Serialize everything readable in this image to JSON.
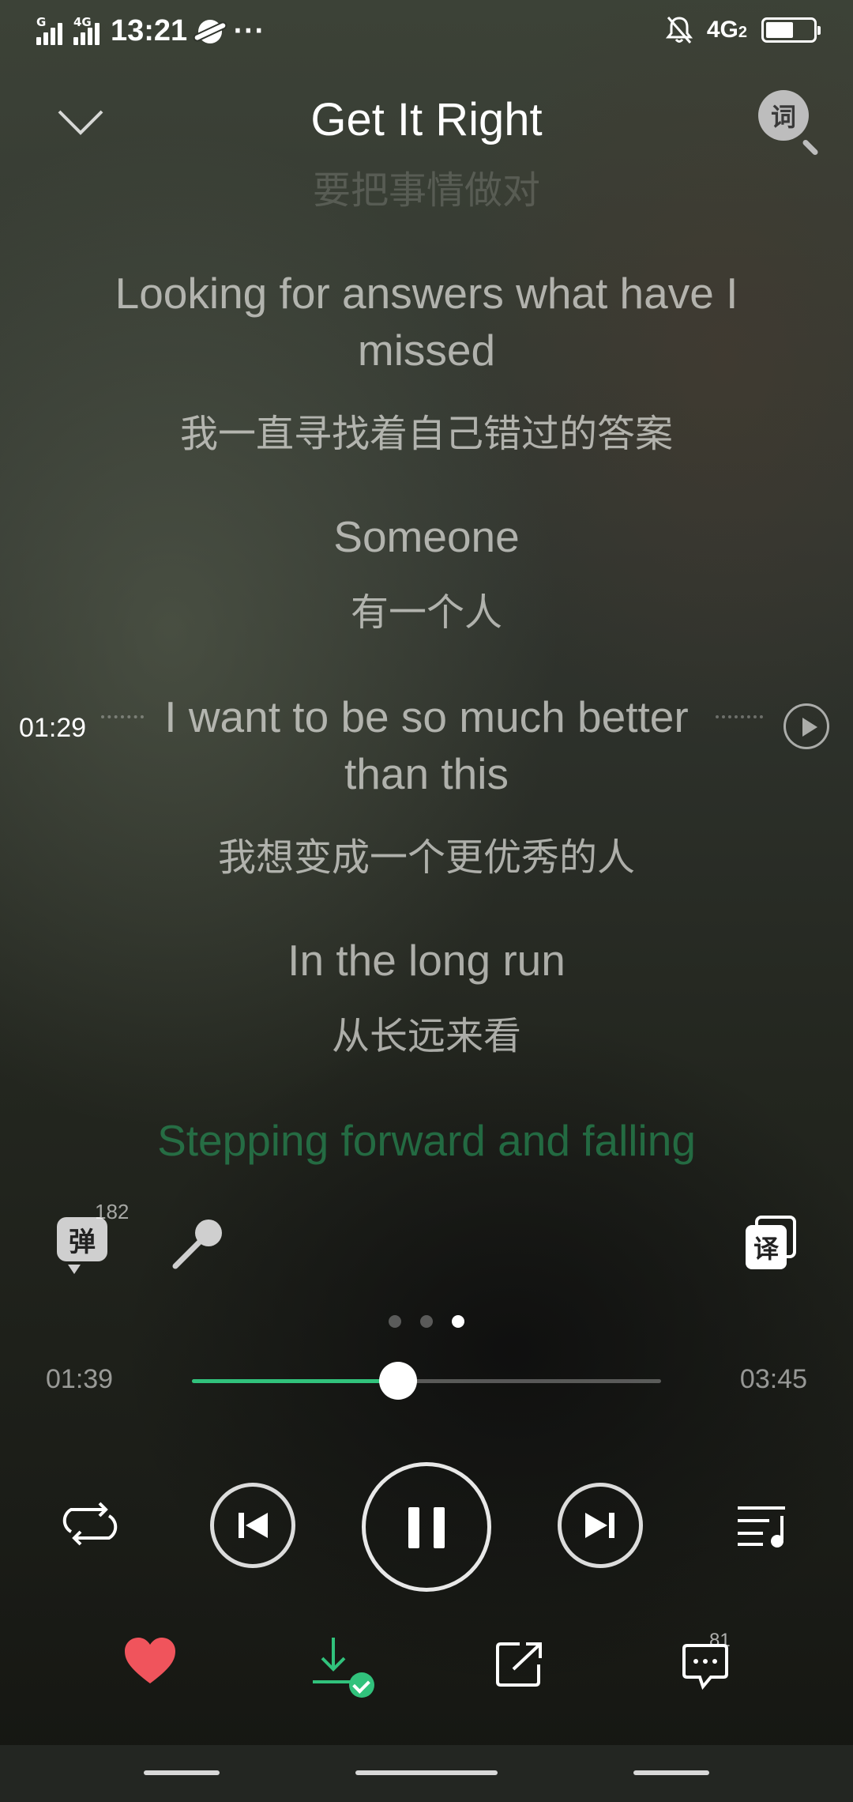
{
  "status_bar": {
    "sim1_tag": "G",
    "sim2_tag": "4G",
    "time": "13:21",
    "more": "···",
    "network": "4G",
    "network_sub": "2"
  },
  "header": {
    "title": "Get It Right",
    "lyric_search_glyph": "词"
  },
  "lyrics": {
    "lines": [
      {
        "text": "要把事情做对"
      },
      {
        "text": "Looking for answers what have I missed"
      },
      {
        "text": "我一直寻找着自己错过的答案"
      },
      {
        "text": "Someone"
      },
      {
        "text": "有一个人"
      },
      {
        "text": "I want to be so much better than this"
      },
      {
        "text": "我想变成一个更优秀的人"
      },
      {
        "text": "In the long run"
      },
      {
        "text": "从长远来看"
      },
      {
        "text": "Stepping forward and falling"
      }
    ],
    "scrub_time": "01:29"
  },
  "tools": {
    "danmu_glyph": "弹",
    "danmu_count": "182",
    "translate_glyph": "译"
  },
  "pager": {
    "count": 3,
    "active": 3
  },
  "progress": {
    "current": "01:39",
    "total": "03:45",
    "fraction": 0.44
  },
  "actions": {
    "comment_count": "81"
  },
  "colors": {
    "accent": "#31c27c",
    "like": "#f0545c"
  },
  "icons": [
    "chevron-down-icon",
    "lyric-search-icon",
    "danmu-icon",
    "microphone-icon",
    "translate-icon",
    "repeat-icon",
    "previous-icon",
    "pause-icon",
    "next-icon",
    "playlist-icon",
    "heart-icon",
    "download-icon",
    "share-icon",
    "comment-icon"
  ]
}
